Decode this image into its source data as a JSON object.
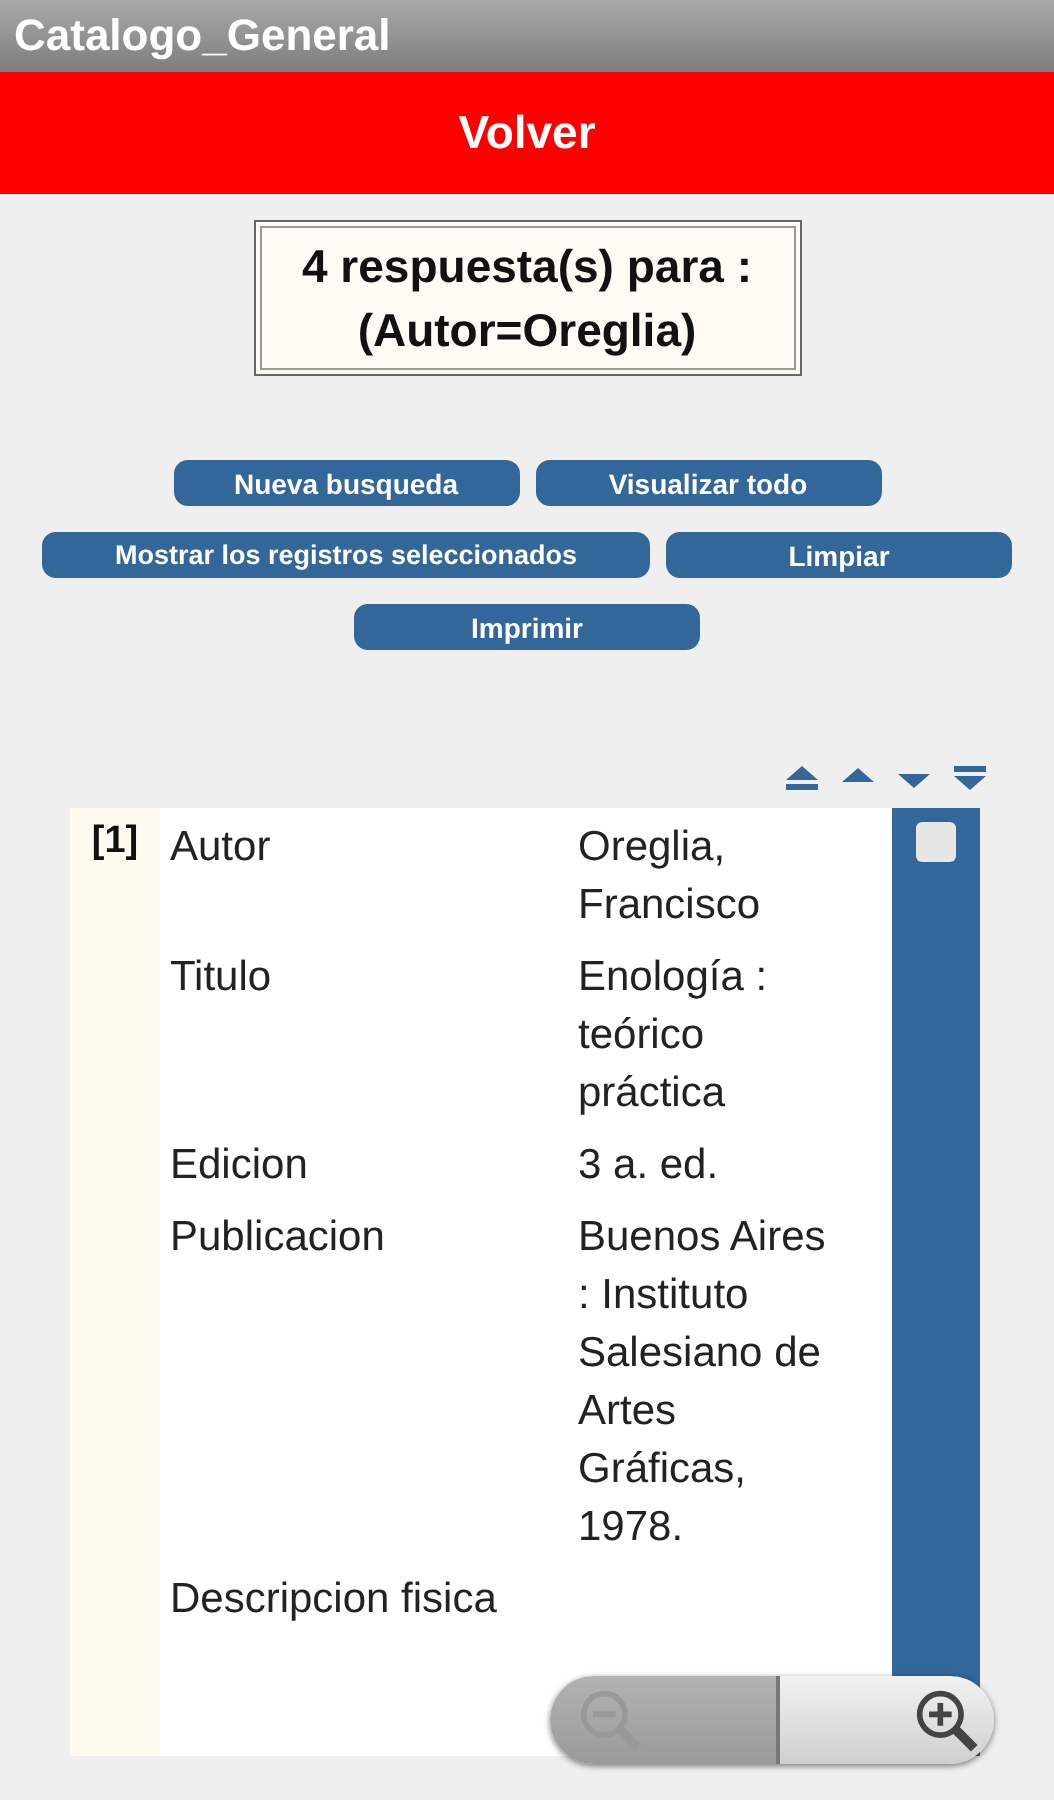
{
  "window": {
    "title": "Catalogo_General"
  },
  "back_button": {
    "label": "Volver"
  },
  "result_summary": {
    "lines": [
      "4 respuesta(s) para :",
      "(Autor=Oreglia)"
    ]
  },
  "action_rows": [
    [
      "Nueva busqueda",
      "Visualizar todo"
    ],
    [
      "Mostrar los registros seleccionados",
      "Limpiar"
    ],
    [
      "Imprimir"
    ]
  ],
  "records": [
    {
      "number": "[1]",
      "checked": false,
      "fields": [
        {
          "label": "Autor",
          "value": "Oreglia, Francisco"
        },
        {
          "label": "Titulo",
          "value": "Enología : teórico práctica"
        },
        {
          "label": "Edicion",
          "value": "3 a. ed."
        },
        {
          "label": "Publicacion",
          "value": "Buenos Aires : Instituto Salesiano de Artes Gráficas, 1978."
        },
        {
          "label": "Descripcion fisica"
        }
      ]
    }
  ],
  "zoom_controls": {
    "zoom_out_disabled": true,
    "zoom_in_disabled": false
  }
}
